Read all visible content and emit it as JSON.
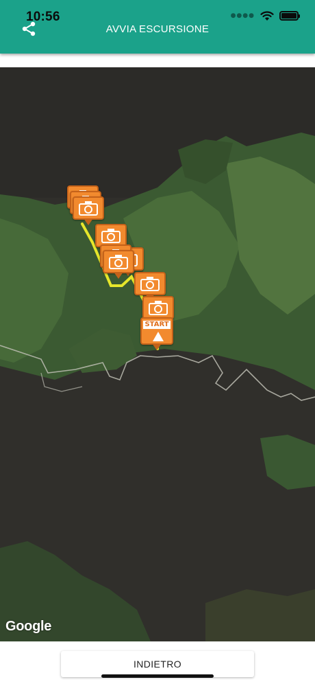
{
  "status_bar": {
    "time": "10:56"
  },
  "header": {
    "title": "AVVIA ESCURSIONE",
    "share_icon": "share-icon"
  },
  "map": {
    "attribution": "Google",
    "start_marker_label": "START",
    "photo_marker_icon": "camera-icon",
    "marker_color": "#f28a2e",
    "track_color": "#e6e62b"
  },
  "footer": {
    "back_label": "INDIETRO"
  },
  "colors": {
    "accent": "#1ba28a"
  }
}
